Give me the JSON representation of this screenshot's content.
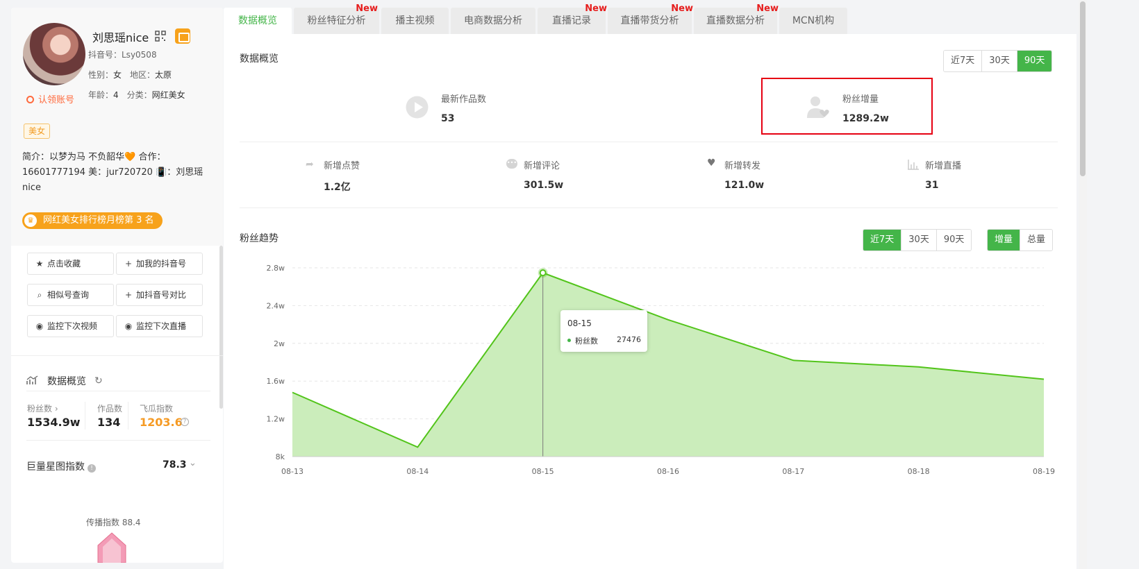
{
  "profile": {
    "name": "刘思瑶nice",
    "douyin_id": "抖音号：Lsy0508",
    "gender_label": "性别：",
    "gender": "女",
    "region_label": "地区：",
    "region": "太原",
    "age_label": "年龄：",
    "age": "4",
    "category_label": "分类：",
    "category": "网红美女",
    "claim": "认领账号",
    "tag": "美女",
    "bio_line1": "简介：以梦为马 不负韶华🧡 合作：",
    "bio_line2": "16601777194 美：jur720720 📳：刘思瑶",
    "bio_line3": "nice",
    "rank_text": "网红美女排行榜月榜第 3 名"
  },
  "actions": {
    "favorite": "点击收藏",
    "add_my_douyin": "加我的抖音号",
    "similar_search": "相似号查询",
    "add_compare": "加抖音号对比",
    "monitor_video": "监控下次视频",
    "monitor_live": "监控下次直播"
  },
  "sidebar_overview": {
    "title": "数据概览",
    "fans_label": "粉丝数 ›",
    "fans_value": "1534.9w",
    "works_label": "作品数",
    "works_value": "134",
    "feigua_label": "飞瓜指数",
    "feigua_value": "1203.6",
    "juliang_label": "巨量星图指数",
    "juliang_value": "78.3",
    "spread_label": "传播指数 88.4"
  },
  "tabs": [
    {
      "label": "数据概览",
      "new": ""
    },
    {
      "label": "粉丝特征分析",
      "new": "New"
    },
    {
      "label": "播主视频",
      "new": ""
    },
    {
      "label": "电商数据分析",
      "new": ""
    },
    {
      "label": "直播记录",
      "new": "New"
    },
    {
      "label": "直播带货分析",
      "new": "New"
    },
    {
      "label": "直播数据分析",
      "new": "New"
    },
    {
      "label": "MCN机构",
      "new": ""
    }
  ],
  "overview": {
    "title": "数据概览",
    "range": [
      "近7天",
      "30天",
      "90天"
    ],
    "range_selected": "90天",
    "latest_works_label": "最新作品数",
    "latest_works_value": "53",
    "fans_growth_label": "粉丝增量",
    "fans_growth_value": "1289.2w",
    "metrics": [
      {
        "label": "新增点赞",
        "value": "1.2亿",
        "icon": "share-icon"
      },
      {
        "label": "新增评论",
        "value": "301.5w",
        "icon": "comment-icon"
      },
      {
        "label": "新增转发",
        "value": "121.0w",
        "icon": "heart-icon"
      },
      {
        "label": "新增直播",
        "value": "31",
        "icon": "bar-chart-icon"
      }
    ]
  },
  "trend": {
    "title": "粉丝趋势",
    "range": [
      "近7天",
      "30天",
      "90天"
    ],
    "range_selected": "近7天",
    "mode": [
      "增量",
      "总量"
    ],
    "mode_selected": "增量",
    "tooltip_date": "08-15",
    "tooltip_series": "粉丝数",
    "tooltip_value": "27476"
  },
  "chart_data": {
    "type": "area",
    "x": [
      "08-13",
      "08-14",
      "08-15",
      "08-16",
      "08-17",
      "08-18",
      "08-19"
    ],
    "series": [
      {
        "name": "粉丝数",
        "values": [
          14800,
          9000,
          27476,
          22500,
          18200,
          17500,
          16200
        ]
      }
    ],
    "ytick_labels": [
      "8k",
      "1.2w",
      "1.6w",
      "2w",
      "2.4w",
      "2.8w"
    ],
    "ylim": [
      8000,
      28000
    ],
    "grid": true,
    "highlight_index": 2,
    "colors": {
      "line": "#52c41a",
      "fill": "#cbedbb"
    }
  }
}
